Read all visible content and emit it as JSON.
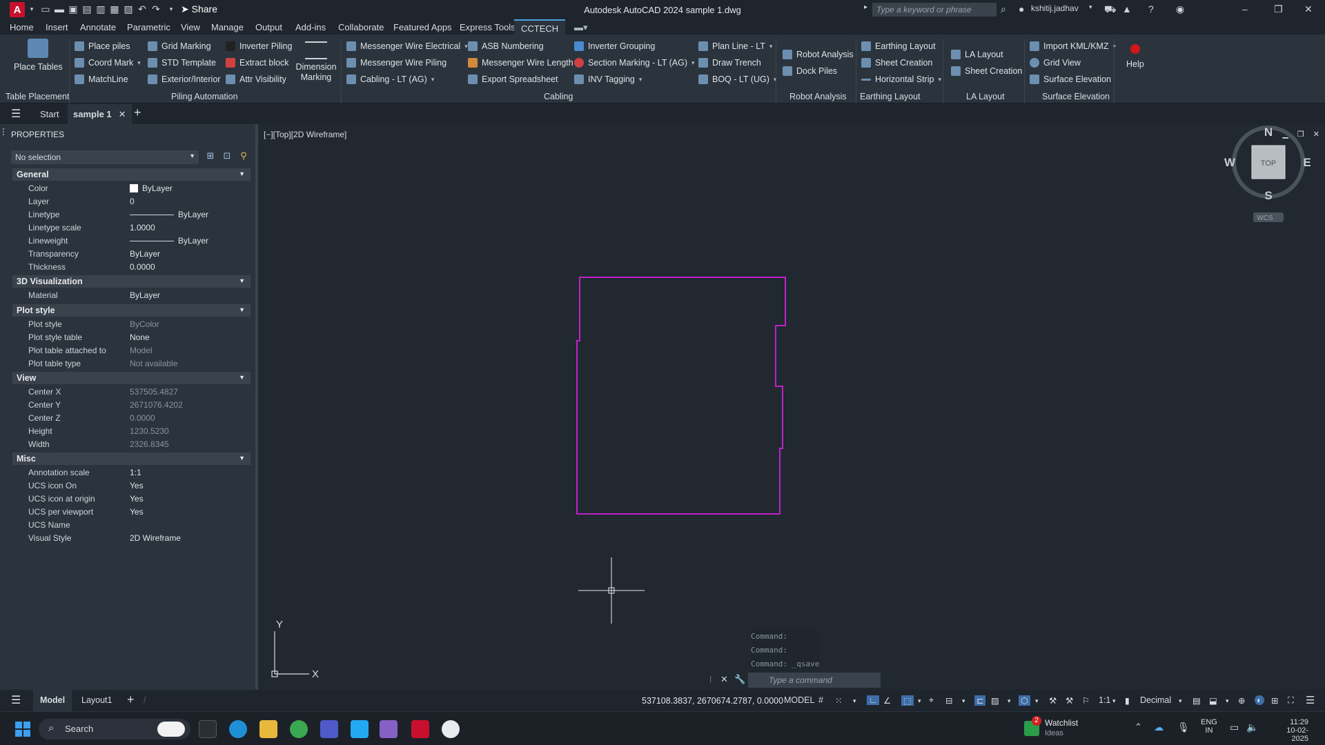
{
  "app": {
    "title": "Autodesk AutoCAD 2024  sample 1.dwg",
    "logo": "A",
    "share_label": "Share",
    "search_placeholder": "Type a keyword or phrase",
    "user": "kshitij.jadhav"
  },
  "menu": [
    "Home",
    "Insert",
    "Annotate",
    "Parametric",
    "View",
    "Manage",
    "Output",
    "Add-ins",
    "Collaborate",
    "Featured Apps",
    "Express Tools",
    "CCTECH"
  ],
  "ribbon": {
    "place_tables": "Place Tables",
    "table_placement": "Table Placement",
    "piling": {
      "place_piles": "Place piles",
      "coord_mark": "Coord Mark",
      "matchline": "MatchLine",
      "grid_marking": "Grid Marking",
      "std_template": "STD Template",
      "exterior_interior": "Exterior/Interior",
      "inverter_piling": "Inverter Piling",
      "extract_block": "Extract block",
      "attr_visibility": "Attr Visibility",
      "dimension_marking": "Dimension Marking",
      "label": "Piling Automation"
    },
    "cabling": {
      "mw_electrical": "Messenger Wire Electrical",
      "mw_piling": "Messenger Wire Piling",
      "cabling_lt": "Cabling - LT (AG)",
      "asb_numbering": "ASB Numbering",
      "mw_length": "Messenger Wire Length",
      "export_spreadsheet": "Export Spreadsheet",
      "inverter_grouping": "Inverter Grouping",
      "section_marking": "Section Marking - LT (AG)",
      "inv_tagging": "INV Tagging",
      "plan_line": "Plan Line - LT",
      "draw_trench": "Draw Trench",
      "boq": "BOQ - LT (UG)",
      "label": "Cabling"
    },
    "robot": {
      "robot_analysis": "Robot Analysis",
      "dock_piles": "Dock Piles",
      "label": "Robot Analysis"
    },
    "earthing": {
      "earthing_layout": "Earthing Layout",
      "sheet_creation": "Sheet Creation",
      "horizontal_strip": "Horizontal Strip",
      "label": "Earthing Layout"
    },
    "la": {
      "la_layout": "LA Layout",
      "sheet_creation": "Sheet Creation",
      "label": "LA Layout"
    },
    "surface": {
      "import_kml": "Import KML/KMZ",
      "grid_view": "Grid View",
      "surface_elevation": "Surface Elevation",
      "label": "Surface Elevation"
    },
    "help": "Help"
  },
  "tabs": {
    "start": "Start",
    "active": "sample 1"
  },
  "properties": {
    "title": "PROPERTIES",
    "selection": "No selection",
    "groups": {
      "general": {
        "title": "General",
        "color": {
          "k": "Color",
          "v": "ByLayer"
        },
        "layer": {
          "k": "Layer",
          "v": "0"
        },
        "linetype": {
          "k": "Linetype",
          "v": "ByLayer"
        },
        "linetype_scale": {
          "k": "Linetype scale",
          "v": "1.0000"
        },
        "lineweight": {
          "k": "Lineweight",
          "v": "ByLayer"
        },
        "transparency": {
          "k": "Transparency",
          "v": "ByLayer"
        },
        "thickness": {
          "k": "Thickness",
          "v": "0.0000"
        }
      },
      "viz": {
        "title": "3D Visualization",
        "material": {
          "k": "Material",
          "v": "ByLayer"
        }
      },
      "plot": {
        "title": "Plot style",
        "plot_style": {
          "k": "Plot style",
          "v": "ByColor"
        },
        "plot_style_table": {
          "k": "Plot style table",
          "v": "None"
        },
        "plot_table_attached": {
          "k": "Plot table attached to",
          "v": "Model"
        },
        "plot_table_type": {
          "k": "Plot table type",
          "v": "Not available"
        }
      },
      "view": {
        "title": "View",
        "center_x": {
          "k": "Center X",
          "v": "537505.4827"
        },
        "center_y": {
          "k": "Center Y",
          "v": "2671076.4202"
        },
        "center_z": {
          "k": "Center Z",
          "v": "0.0000"
        },
        "height": {
          "k": "Height",
          "v": "1230.5230"
        },
        "width": {
          "k": "Width",
          "v": "2326.8345"
        }
      },
      "misc": {
        "title": "Misc",
        "annotation_scale": {
          "k": "Annotation scale",
          "v": "1:1"
        },
        "ucs_icon_on": {
          "k": "UCS icon On",
          "v": "Yes"
        },
        "ucs_icon_origin": {
          "k": "UCS icon at origin",
          "v": "Yes"
        },
        "ucs_per_viewport": {
          "k": "UCS per viewport",
          "v": "Yes"
        },
        "ucs_name": {
          "k": "UCS Name",
          "v": ""
        },
        "visual_style": {
          "k": "Visual Style",
          "v": "2D Wireframe"
        }
      }
    }
  },
  "viewport": {
    "label": "[−][Top][2D Wireframe]",
    "viewcube": {
      "n": "N",
      "s": "S",
      "e": "E",
      "w": "W",
      "top": "TOP",
      "wcs": "WCS"
    },
    "ucs": {
      "x": "X",
      "y": "Y"
    },
    "outline_color": "#c020c8"
  },
  "command": {
    "history": [
      "Command:",
      "Command:",
      "Command:  _qsave"
    ],
    "placeholder": "Type a command"
  },
  "layout": {
    "model": "Model",
    "layout1": "Layout1"
  },
  "status": {
    "coords": "537108.3837, 2670674.2787, 0.0000",
    "model": "MODEL",
    "scale": "1:1",
    "units": "Decimal"
  },
  "taskbar": {
    "search": "Search",
    "watchlist": "Watchlist",
    "watchlist_sub": "Ideas",
    "badge": "2",
    "lang": "ENG",
    "region": "IN",
    "time": "11:29",
    "date": "10-02-2025"
  }
}
